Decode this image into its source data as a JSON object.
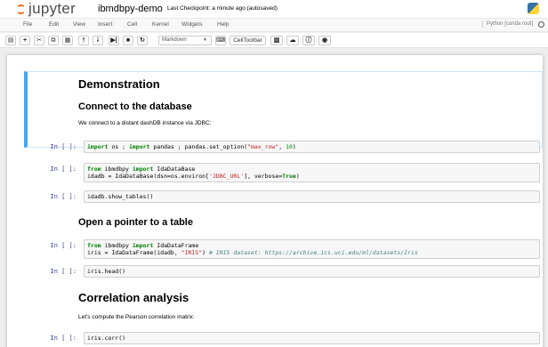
{
  "header": {
    "logo_text": "jupyter",
    "notebook_name": "ibmdbpy-demo",
    "checkpoint": "Last Checkpoint: a minute ago (autosaved)"
  },
  "menubar": {
    "items": [
      "File",
      "Edit",
      "View",
      "Insert",
      "Cell",
      "Kernel",
      "Widgets",
      "Help"
    ],
    "kernel_name": "Python [conda root]"
  },
  "toolbar": {
    "cell_type": "Markdown",
    "celltoolbar_label": "CellToolbar",
    "icons": [
      "save-icon",
      "plus-icon",
      "cut-icon",
      "copy-icon",
      "paste-icon",
      "arrow-up-icon",
      "arrow-down-icon",
      "step-forward-icon",
      "stop-icon",
      "restart-icon",
      "keyboard-icon",
      "chart-icon",
      "upload-icon",
      "info-icon",
      "video-icon"
    ]
  },
  "cells": {
    "demo_title": "Demonstration",
    "connect_heading": "Connect to the database",
    "connect_text": "We connect to a distant dashDB instance via JDBC:",
    "prompt": "In [ ]:",
    "code1": {
      "kw1": "import",
      "t1": " os ; ",
      "kw2": "import",
      "t2": " pandas ; pandas.set_option(",
      "s1": "\"max_row\"",
      "t3": ", ",
      "n1": "10",
      "t4": ")"
    },
    "code2": {
      "kw1": "from",
      "t1": " ibmdbpy ",
      "kw2": "import",
      "t2": " IdaDataBase",
      "t3": "idadb = IdaDataBase(dsn=os.environ[",
      "s1": "'JDBC_URL'",
      "t4": "], verbose=",
      "kw3": "True",
      "t5": ")"
    },
    "code3": "idadb.show_tables()",
    "pointer_heading": "Open a pointer to a table",
    "code4": {
      "kw1": "from",
      "t1": " ibmdbpy ",
      "kw2": "import",
      "t2": " IdaDataFrame",
      "t3": "iris = IdaDataFrame(idadb, ",
      "s1": "\"IRIS\"",
      "t4": ") ",
      "c1": "# IRIS dataset: https://archive.ics.uci.edu/ml/datasets/Iris"
    },
    "code5": "iris.head()",
    "corr_heading": "Correlation analysis",
    "corr_text": "Let's compute the Pearson correlation matrix:",
    "code6": "iris.corr()"
  }
}
